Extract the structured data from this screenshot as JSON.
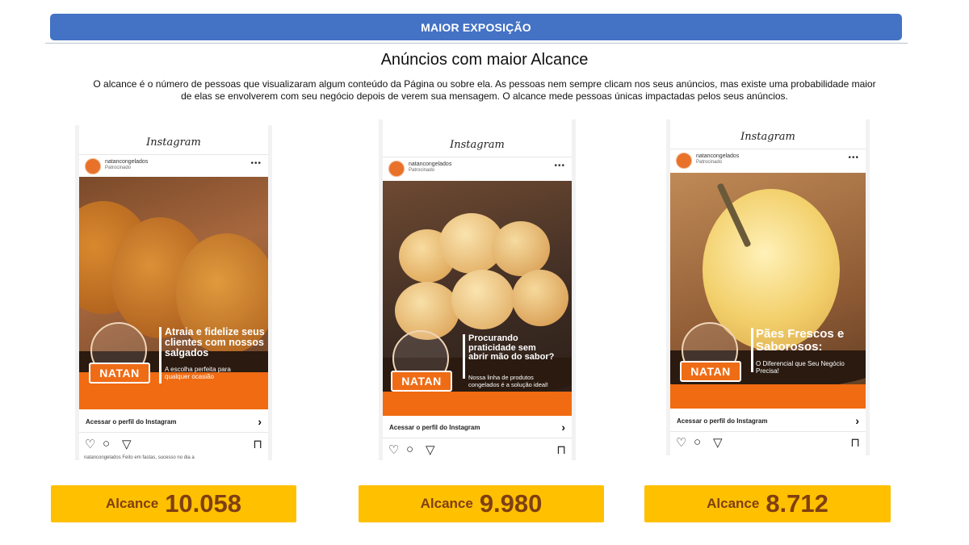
{
  "header": {
    "banner_label": "MAIOR EXPOSIÇÃO"
  },
  "section": {
    "title": "Anúncios com maior Alcance",
    "description": "O alcance é o número de pessoas que visualizaram algum conteúdo da Página ou sobre ela. As pessoas nem sempre clicam nos seus anúncios, mas existe uma probabilidade maior de elas se envolverem com seu negócio depois de verem sua mensagem. O alcance mede pessoas únicas impactadas pelos seus anúncios."
  },
  "ads": [
    {
      "platform": "Instagram",
      "account": "natancongelados",
      "sponsored": "Patrocinado",
      "headline": "Atraia e fidelize seus clientes com nossos salgados",
      "subline": "A escolha perfeita para qualquer ocasião",
      "brand": "NATAN",
      "cta": "Acessar o perfil do Instagram",
      "caption": "natancongelados Feito em fastas, sucesso no dia a",
      "reach_label": "Alcance",
      "reach_value": "10.058"
    },
    {
      "platform": "Instagram",
      "account": "natancongelados",
      "sponsored": "Patrocinado",
      "headline": "Procurando praticidade sem abrir mão do sabor?",
      "subline": "Nossa linha de produtos congelados é a solução ideal!",
      "brand": "NATAN",
      "cta": "Acessar o perfil do Instagram",
      "reach_label": "Alcance",
      "reach_value": "9.980"
    },
    {
      "platform": "Instagram",
      "account": "natancongelados",
      "sponsored": "Patrocinado",
      "headline": "Pães Frescos e Saborosos:",
      "subline": "O Diferencial que Seu Negócio Precisa!",
      "brand": "NATAN",
      "cta": "Acessar o perfil do Instagram",
      "reach_label": "Alcance",
      "reach_value": "8.712"
    }
  ],
  "icons": [
    "more-icon",
    "chevron-right-icon",
    "heart-icon",
    "comment-icon",
    "send-icon",
    "bookmark-icon"
  ],
  "colors": {
    "banner": "#4472c4",
    "reach_pill": "#ffc000",
    "reach_text": "#7f3f12",
    "brand_orange": "#ef6c16"
  }
}
